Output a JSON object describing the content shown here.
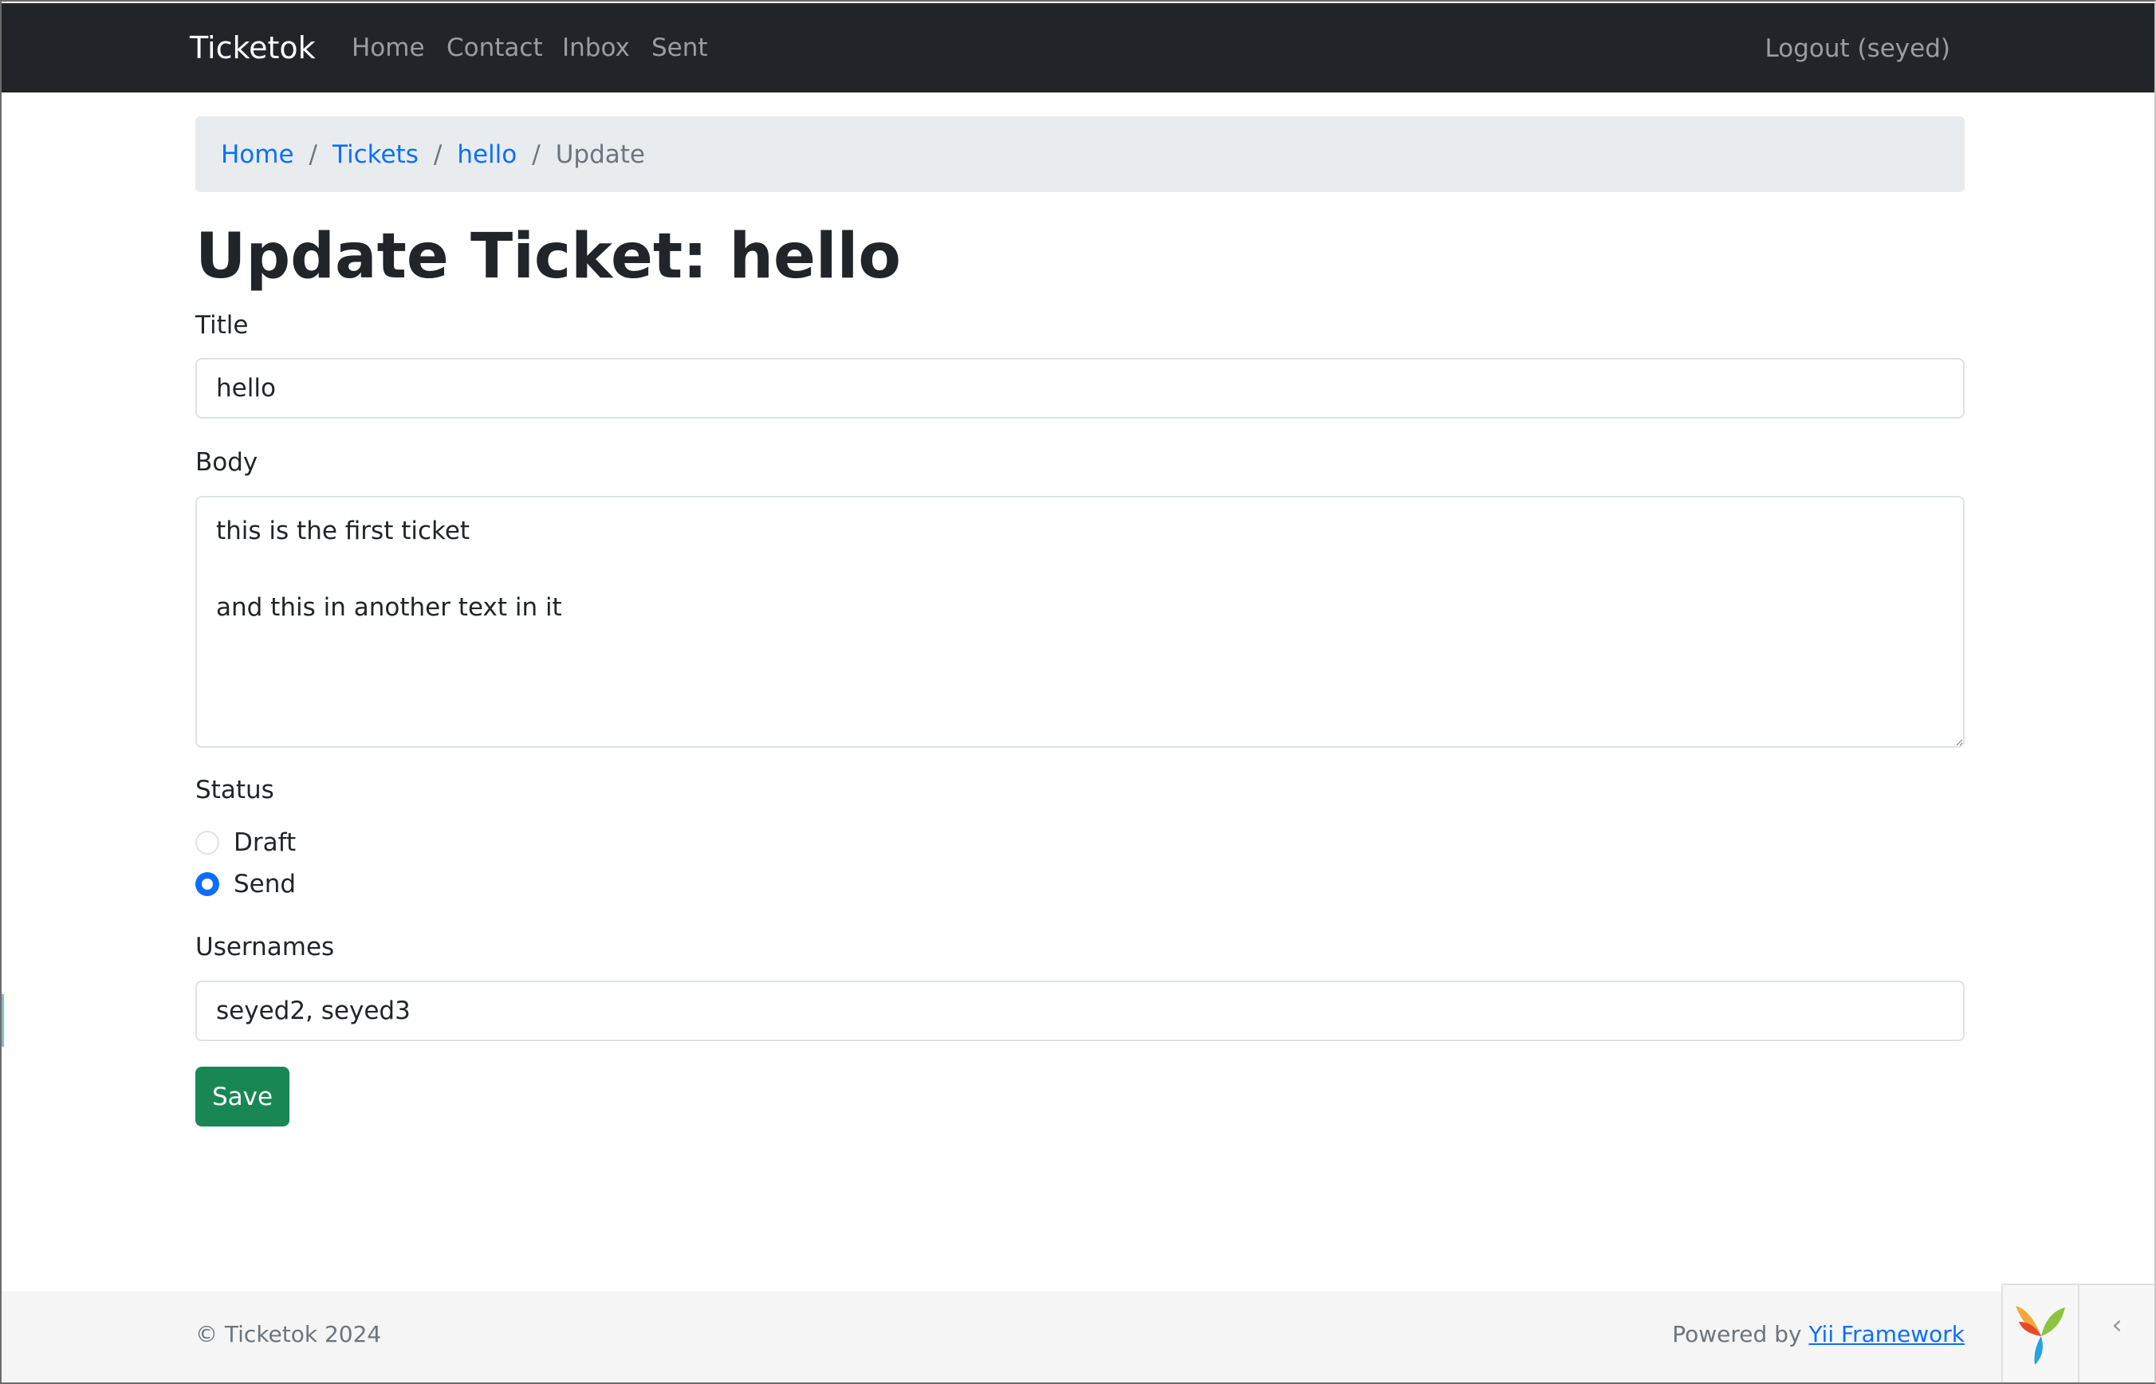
{
  "navbar": {
    "brand": "Ticketok",
    "links": [
      "Home",
      "Contact",
      "Inbox",
      "Sent"
    ],
    "logout": "Logout (seyed)"
  },
  "breadcrumb": {
    "items": [
      "Home",
      "Tickets",
      "hello"
    ],
    "separator": "/",
    "active": "Update"
  },
  "page": {
    "title": "Update Ticket: hello"
  },
  "form": {
    "title_label": "Title",
    "title_value": "hello",
    "body_label": "Body",
    "body_value": "this is the first ticket\n\nand this in another text in it",
    "status_label": "Status",
    "status_options": [
      "Draft",
      "Send"
    ],
    "status_selected": "Send",
    "usernames_label": "Usernames",
    "usernames_value": "seyed2, seyed3",
    "save_label": "Save"
  },
  "footer": {
    "copyright": "© Ticketok 2024",
    "powered_by": "Powered by ",
    "framework_link": "Yii Framework"
  },
  "debug_toolbar": {
    "logo_icon": "yii-logo-icon",
    "collapse_icon": "chevron-left-icon",
    "collapse_glyph": "‹"
  },
  "colors": {
    "navbar_bg": "#212529",
    "link": "#0d6efd",
    "save_button": "#198754",
    "radio_checked": "#0d6efd"
  }
}
